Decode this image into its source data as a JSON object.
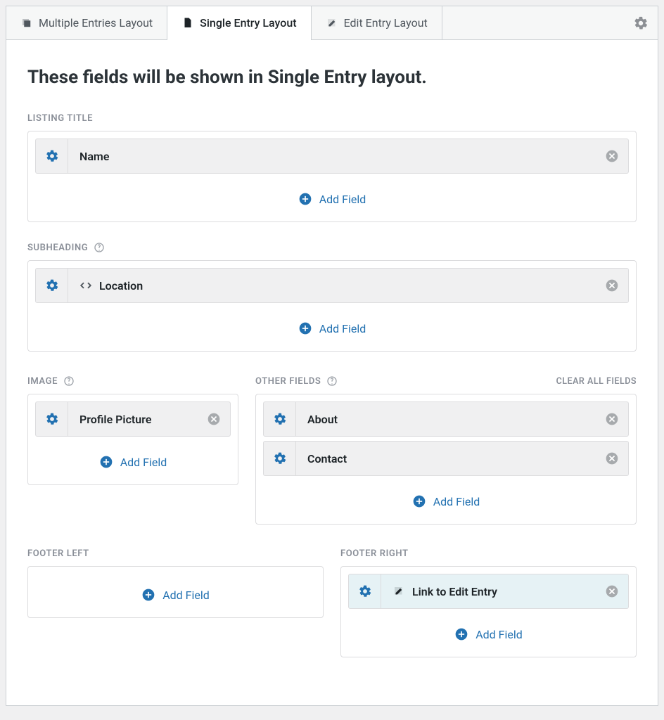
{
  "tabs": {
    "multiple": "Multiple Entries Layout",
    "single": "Single Entry Layout",
    "edit": "Edit Entry Layout"
  },
  "title": "These fields will be shown in Single Entry layout.",
  "actions": {
    "add_field": "Add Field",
    "clear_all": "CLEAR ALL FIELDS"
  },
  "sections": {
    "listing_title": {
      "label": "LISTING TITLE",
      "fields": [
        {
          "name": "Name"
        }
      ]
    },
    "subheading": {
      "label": "SUBHEADING",
      "help": true,
      "fields": [
        {
          "name": "Location",
          "icon": "code"
        }
      ]
    },
    "image": {
      "label": "IMAGE",
      "help": true,
      "fields": [
        {
          "name": "Profile Picture"
        }
      ]
    },
    "other_fields": {
      "label": "OTHER FIELDS",
      "help": true,
      "clear_all": true,
      "fields": [
        {
          "name": "About"
        },
        {
          "name": "Contact"
        }
      ]
    },
    "footer_left": {
      "label": "FOOTER LEFT",
      "fields": []
    },
    "footer_right": {
      "label": "FOOTER RIGHT",
      "fields": [
        {
          "name": "Link to Edit Entry",
          "icon": "edit",
          "highlight": true
        }
      ]
    }
  }
}
